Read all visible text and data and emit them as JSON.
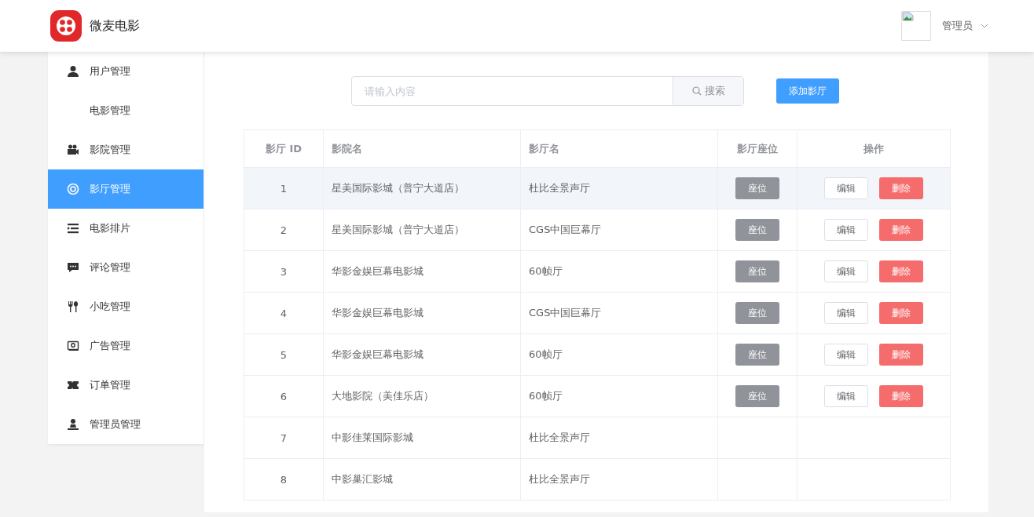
{
  "header": {
    "app_name": "微麦电影",
    "user": {
      "name": "管理员"
    }
  },
  "sidebar": {
    "items": [
      {
        "label": "用户管理",
        "selected": false
      },
      {
        "label": "电影管理",
        "selected": false
      },
      {
        "label": "影院管理",
        "selected": false
      },
      {
        "label": "影厅管理",
        "selected": true
      },
      {
        "label": "电影排片",
        "selected": false
      },
      {
        "label": "评论管理",
        "selected": false
      },
      {
        "label": "小吃管理",
        "selected": false
      },
      {
        "label": "广告管理",
        "selected": false
      },
      {
        "label": "订单管理",
        "selected": false
      },
      {
        "label": "管理员管理",
        "selected": false
      }
    ]
  },
  "toolbar": {
    "search": {
      "placeholder": "请输入内容",
      "button": "搜索"
    },
    "add_button": "添加影厅"
  },
  "table": {
    "columns": [
      "影厅 ID",
      "影院名",
      "影厅名",
      "影厅座位",
      "操作"
    ],
    "rows": [
      {
        "id": "1",
        "cinema": "星美国际影城（普宁大道店）",
        "hall": "杜比全景声厅",
        "hovered": true,
        "seat_button": "座位",
        "edit_button": "编辑",
        "delete_button": "删除"
      },
      {
        "id": "2",
        "cinema": "星美国际影城（普宁大道店）",
        "hall": "CGS中国巨幕厅",
        "hovered": false,
        "seat_button": "座位",
        "edit_button": "编辑",
        "delete_button": "删除"
      },
      {
        "id": "3",
        "cinema": "华影金娱巨幕电影城",
        "hall": "60帧厅",
        "hovered": false,
        "seat_button": "座位",
        "edit_button": "编辑",
        "delete_button": "删除"
      },
      {
        "id": "4",
        "cinema": "华影金娱巨幕电影城",
        "hall": "CGS中国巨幕厅",
        "hovered": false,
        "seat_button": "座位",
        "edit_button": "编辑",
        "delete_button": "删除"
      },
      {
        "id": "5",
        "cinema": "华影金娱巨幕电影城",
        "hall": "60帧厅",
        "hovered": false,
        "seat_button": "座位",
        "edit_button": "编辑",
        "delete_button": "删除"
      },
      {
        "id": "6",
        "cinema": "大地影院（美佳乐店）",
        "hall": "60帧厅",
        "hovered": false,
        "seat_button": "座位",
        "edit_button": "编辑",
        "delete_button": "删除"
      },
      {
        "id": "7",
        "cinema": "中影佳莱国际影城",
        "hall": "杜比全景声厅",
        "hovered": false
      },
      {
        "id": "8",
        "cinema": "中影巢汇影城",
        "hall": "杜比全景声厅",
        "hovered": false
      }
    ]
  }
}
